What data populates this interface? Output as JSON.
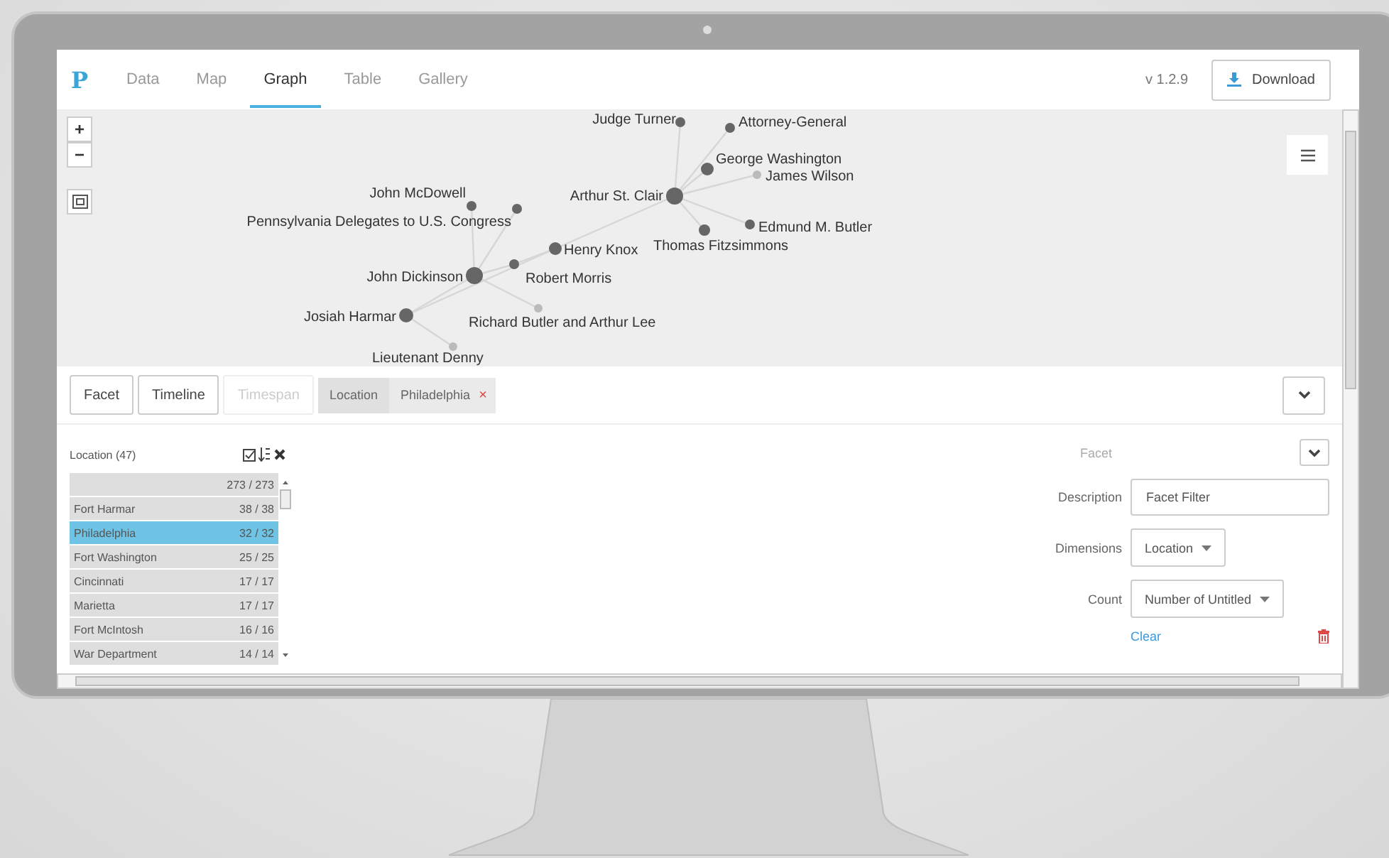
{
  "nav": {
    "logo": "P",
    "tabs": [
      {
        "label": "Data",
        "selected": false
      },
      {
        "label": "Map",
        "selected": false
      },
      {
        "label": "Graph",
        "selected": true
      },
      {
        "label": "Table",
        "selected": false
      },
      {
        "label": "Gallery",
        "selected": false
      }
    ],
    "version": "v 1.2.9",
    "download": "Download"
  },
  "graph": {
    "zoom_in": "+",
    "zoom_out": "−",
    "nodes": [
      {
        "label": "Judge Turner"
      },
      {
        "label": "Attorney-General"
      },
      {
        "label": "George Washington"
      },
      {
        "label": "James Wilson"
      },
      {
        "label": "Arthur St. Clair"
      },
      {
        "label": "Pennsylvania Delegates to U.S. Congress"
      },
      {
        "label": "John McDowell"
      },
      {
        "label": "Henry Knox"
      },
      {
        "label": "Robert Morris"
      },
      {
        "label": "John Dickinson"
      },
      {
        "label": "Thomas Fitzsimmons"
      },
      {
        "label": "Edmund M. Butler"
      },
      {
        "label": "Josiah Harmar"
      },
      {
        "label": "Richard Butler and Arthur Lee"
      },
      {
        "label": "Lieutenant Denny"
      }
    ]
  },
  "panel": {
    "tabs": [
      {
        "label": "Facet",
        "disabled": false
      },
      {
        "label": "Timeline",
        "disabled": false
      },
      {
        "label": "Timespan",
        "disabled": true
      }
    ],
    "filter": {
      "dimension": "Location",
      "value": "Philadelphia",
      "remove": "×"
    }
  },
  "facet_list": {
    "title": "Location (47)",
    "rows": [
      {
        "count": "273 / 273",
        "selected": false
      },
      {
        "name": "Fort Harmar",
        "count": "38 / 38",
        "selected": false
      },
      {
        "name": "Philadelphia",
        "count": "32 / 32",
        "selected": true
      },
      {
        "name": "Fort Washington",
        "count": "25 / 25",
        "selected": false
      },
      {
        "name": "Cincinnati",
        "count": "17 / 17",
        "selected": false
      },
      {
        "name": "Marietta",
        "count": "17 / 17",
        "selected": false
      },
      {
        "name": "Fort McIntosh",
        "count": "16 / 16",
        "selected": false
      },
      {
        "name": "War Department",
        "count": "14 / 14",
        "selected": false
      }
    ]
  },
  "form": {
    "title": "Facet",
    "fields": [
      {
        "kind": "input",
        "label": "Description",
        "value": "Facet Filter"
      },
      {
        "kind": "select",
        "label": "Dimensions",
        "value": "Location"
      },
      {
        "kind": "select",
        "label": "Count",
        "value": "Number of Untitled"
      }
    ],
    "clear": "Clear"
  }
}
